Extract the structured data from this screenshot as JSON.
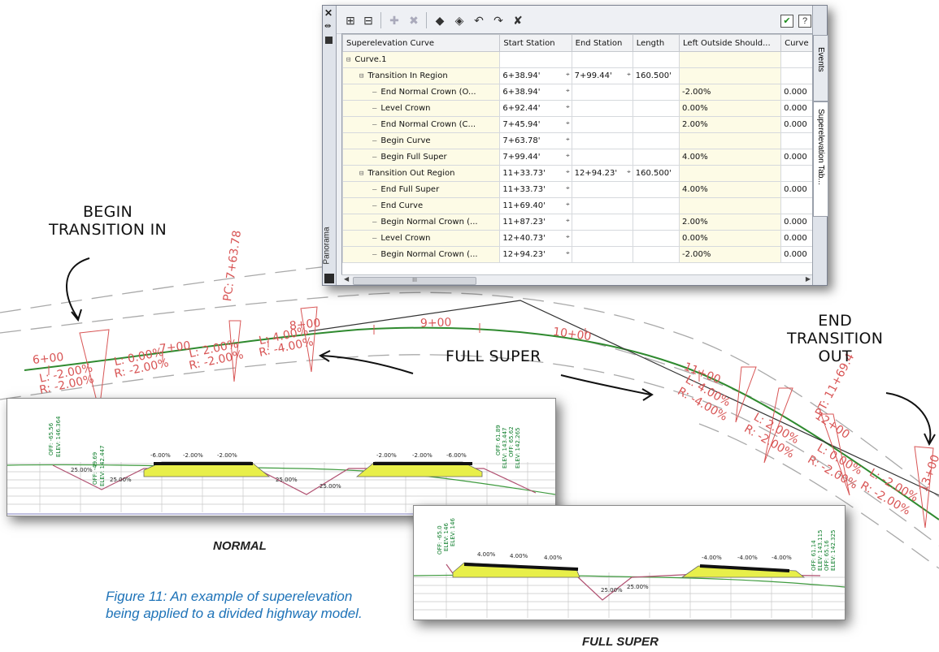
{
  "callouts": {
    "begin_transition_in": [
      "BEGIN",
      "TRANSITION IN"
    ],
    "full_super": "FULL SUPER",
    "end_transition_out": [
      "END",
      "TRANSITION",
      "OUT"
    ]
  },
  "section_labels": {
    "normal": "NORMAL",
    "full_super": "FULL SUPER"
  },
  "figure_caption": "Figure 11: An example of superelevation being applied to a divided highway model.",
  "plan_view_labels": {
    "stations": [
      "6+00",
      "7+00",
      "8+00",
      "9+00",
      "10+00",
      "11+00",
      "12+00",
      "13+00"
    ],
    "pc_label": "PC: 7+63.78",
    "pt_label": "PT: 11+69.4",
    "slopes": [
      [
        "L: -2.00%",
        "R: -2.00%"
      ],
      [
        "L: 0.00%",
        "R: -2.00%"
      ],
      [
        "L: 2.00%",
        "R: -2.00%"
      ],
      [
        "L: 4.00%",
        "R: -4.00%"
      ],
      [
        "L: 4.00%",
        "R: -4.00%"
      ],
      [
        "L: 2.00%",
        "R: -2.00%"
      ],
      [
        "L: 0.00%",
        "R: -2.00%"
      ],
      [
        "L: -2.00%",
        "R: -2.00%"
      ]
    ]
  },
  "normal_section": {
    "slopes": [
      "-6.00%",
      "-2.00%",
      "-2.00%",
      "-2.00%",
      "-2.00%",
      "-6.00%",
      "25.00%",
      "25.00%",
      "25.00%",
      "25.00%"
    ],
    "elevations": [
      "OFF: -65.56",
      "ELEV: 146.364",
      "OFF: -49.69",
      "ELEV: 142.447",
      "OFF: 61.89",
      "ELEV: 143.447",
      "OFF: 65.62",
      "ELEV: 142.265"
    ]
  },
  "full_super_section": {
    "slopes": [
      "4.00%",
      "4.00%",
      "4.00%",
      "-4.00%",
      "-4.00%",
      "-4.00%",
      "25.00%",
      "25.00%"
    ],
    "elevations": [
      "OFF: -65.0",
      "ELEV: 146",
      "ELEV: 146",
      "OFF: 61.14",
      "ELEV: 143.115",
      "OFF: 65.16",
      "ELEV: 142.325"
    ]
  },
  "panorama": {
    "side_title": "Panorama",
    "tabs": [
      "Events",
      "Superelevation Tab..."
    ],
    "scroll_grip": "III",
    "columns": [
      "Superelevation Curve",
      "Start Station",
      "End Station",
      "Length",
      "Left Outside Should...",
      "Curve"
    ],
    "rows": [
      {
        "tree": "⊟",
        "indent": 0,
        "name": "Curve.1",
        "start": "",
        "end": "",
        "length": "",
        "left": "",
        "curve": ""
      },
      {
        "tree": "⊟",
        "indent": 1,
        "name": "Transition In Region",
        "start": "6+38.94'",
        "end": "7+99.44'",
        "length": "160.500'",
        "left": "",
        "curve": ""
      },
      {
        "tree": "—",
        "indent": 2,
        "name": "End Normal Crown (O...",
        "start": "6+38.94'",
        "end": "",
        "length": "",
        "left": "-2.00%",
        "curve": "0.000"
      },
      {
        "tree": "—",
        "indent": 2,
        "name": "Level Crown",
        "start": "6+92.44'",
        "end": "",
        "length": "",
        "left": "0.00%",
        "curve": "0.000"
      },
      {
        "tree": "—",
        "indent": 2,
        "name": "End Normal Crown (C...",
        "start": "7+45.94'",
        "end": "",
        "length": "",
        "left": "2.00%",
        "curve": "0.000"
      },
      {
        "tree": "—",
        "indent": 2,
        "name": "Begin Curve",
        "start": "7+63.78'",
        "end": "",
        "length": "",
        "left": "",
        "curve": ""
      },
      {
        "tree": "—",
        "indent": 2,
        "name": "Begin Full Super",
        "start": "7+99.44'",
        "end": "",
        "length": "",
        "left": "4.00%",
        "curve": "0.000"
      },
      {
        "tree": "⊟",
        "indent": 1,
        "name": "Transition Out Region",
        "start": "11+33.73'",
        "end": "12+94.23'",
        "length": "160.500'",
        "left": "",
        "curve": ""
      },
      {
        "tree": "—",
        "indent": 2,
        "name": "End Full Super",
        "start": "11+33.73'",
        "end": "",
        "length": "",
        "left": "4.00%",
        "curve": "0.000"
      },
      {
        "tree": "—",
        "indent": 2,
        "name": "End Curve",
        "start": "11+69.40'",
        "end": "",
        "length": "",
        "left": "",
        "curve": ""
      },
      {
        "tree": "—",
        "indent": 2,
        "name": "Begin Normal Crown (...",
        "start": "11+87.23'",
        "end": "",
        "length": "",
        "left": "2.00%",
        "curve": "0.000"
      },
      {
        "tree": "—",
        "indent": 2,
        "name": "Level Crown",
        "start": "12+40.73'",
        "end": "",
        "length": "",
        "left": "0.00%",
        "curve": "0.000"
      },
      {
        "tree": "—",
        "indent": 2,
        "name": "Begin Normal Crown (...",
        "start": "12+94.23'",
        "end": "",
        "length": "",
        "left": "-2.00%",
        "curve": "0.000"
      }
    ]
  },
  "colors": {
    "alignment": "#2f8a2f",
    "labels": "#d85555",
    "caption": "#1e73b8",
    "pavement": "#e8ef4a"
  }
}
